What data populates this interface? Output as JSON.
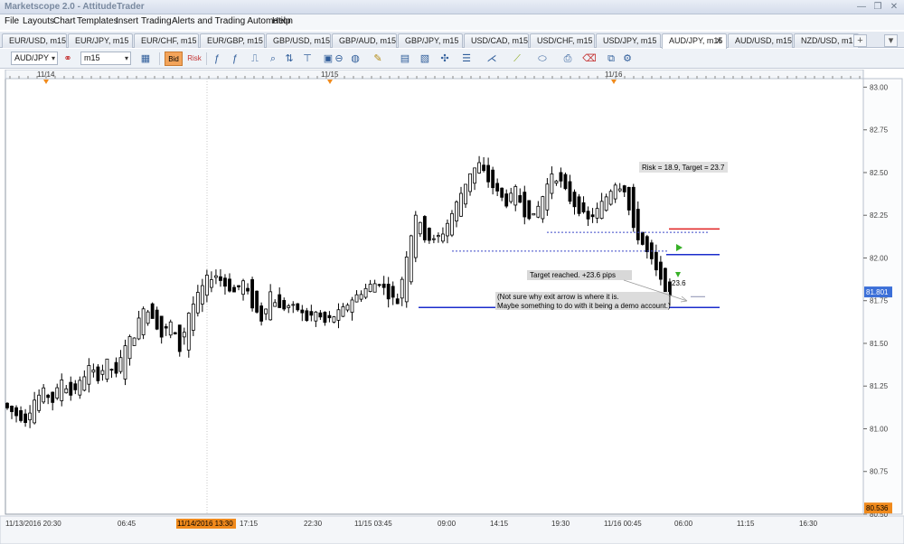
{
  "window": {
    "title": "Marketscope 2.0 - AttitudeTrader",
    "minimize_label": "—",
    "restore_label": "❐",
    "close_label": "✕"
  },
  "menu": [
    "File",
    "Layouts",
    "Chart",
    "Templates",
    "Insert",
    "Trading",
    "Alerts and Trading Automation",
    "Help"
  ],
  "tabs": [
    {
      "label": "EUR/USD, m15",
      "active": false
    },
    {
      "label": "EUR/JPY, m15",
      "active": false
    },
    {
      "label": "EUR/CHF, m15",
      "active": false
    },
    {
      "label": "EUR/GBP, m15",
      "active": false
    },
    {
      "label": "GBP/USD, m15",
      "active": false
    },
    {
      "label": "GBP/AUD, m15",
      "active": false
    },
    {
      "label": "GBP/JPY, m15",
      "active": false
    },
    {
      "label": "USD/CAD, m15",
      "active": false
    },
    {
      "label": "USD/CHF, m15",
      "active": false
    },
    {
      "label": "USD/JPY, m15",
      "active": false
    },
    {
      "label": "AUD/JPY, m15",
      "active": true
    },
    {
      "label": "AUD/USD, m15",
      "active": false
    },
    {
      "label": "NZD/USD, m15",
      "active": false
    }
  ],
  "tabs_extra": {
    "close_label": "✕",
    "add_label": "+",
    "more_label": "▾"
  },
  "toolbar": {
    "symbol": "AUD/JPY",
    "timeframe": "m15",
    "bid_label": "Bid",
    "risk_label": "Risk",
    "dropdown_arrow": "▾"
  },
  "chart_data": {
    "type": "candlestick",
    "symbol": "AUD/JPY",
    "timeframe": "m15",
    "ylim": [
      80.5,
      83.05
    ],
    "y_ticks": [
      "83.00",
      "82.75",
      "82.50",
      "82.25",
      "82.00",
      "81.75",
      "81.50",
      "81.25",
      "81.00",
      "80.75",
      "80.50"
    ],
    "x_labels": [
      "11/13/2016 20:30",
      "06:45",
      "11/14/2016 13:30",
      "17:15",
      "22:30",
      "11/15 03:45",
      "09:00",
      "14:15",
      "19:30",
      "11/16 00:45",
      "06:00",
      "11:15",
      "16:30"
    ],
    "highlighted_x_label": "11/14/2016 13:30",
    "date_markers": [
      "11/14",
      "11/15",
      "11/16"
    ],
    "current_price": "81.801",
    "bottom_price_marker": "80.536",
    "candles_sampled": [
      [
        81.15,
        81.22,
        81.07,
        81.12
      ],
      [
        81.12,
        81.18,
        81.03,
        81.08
      ],
      [
        81.08,
        81.14,
        80.98,
        81.05
      ],
      [
        81.05,
        81.2,
        81.01,
        81.17
      ],
      [
        81.17,
        81.27,
        81.12,
        81.22
      ],
      [
        81.22,
        81.26,
        81.13,
        81.16
      ],
      [
        81.16,
        81.32,
        81.12,
        81.29
      ],
      [
        81.29,
        81.36,
        81.16,
        81.2
      ],
      [
        81.2,
        81.3,
        81.16,
        81.27
      ],
      [
        81.27,
        81.4,
        81.22,
        81.36
      ],
      [
        81.36,
        81.41,
        81.25,
        81.3
      ],
      [
        81.3,
        81.42,
        81.26,
        81.39
      ],
      [
        81.39,
        81.44,
        81.28,
        81.31
      ],
      [
        81.31,
        81.52,
        81.29,
        81.5
      ],
      [
        81.5,
        81.6,
        81.45,
        81.55
      ],
      [
        81.55,
        81.75,
        81.52,
        81.72
      ],
      [
        81.72,
        81.84,
        81.62,
        81.66
      ],
      [
        81.66,
        81.72,
        81.5,
        81.54
      ],
      [
        81.54,
        81.65,
        81.48,
        81.62
      ],
      [
        81.62,
        81.66,
        81.4,
        81.46
      ],
      [
        81.46,
        81.7,
        81.44,
        81.68
      ],
      [
        81.68,
        81.82,
        81.64,
        81.78
      ],
      [
        81.78,
        81.92,
        81.74,
        81.88
      ],
      [
        81.88,
        81.96,
        81.82,
        81.9
      ],
      [
        81.9,
        81.94,
        81.8,
        81.84
      ],
      [
        81.84,
        81.9,
        81.76,
        81.8
      ],
      [
        81.8,
        81.99,
        81.78,
        81.86
      ],
      [
        81.86,
        81.91,
        81.7,
        81.72
      ],
      [
        81.72,
        81.8,
        81.58,
        81.64
      ],
      [
        81.64,
        81.84,
        81.6,
        81.8
      ],
      [
        81.8,
        81.86,
        81.68,
        81.7
      ],
      [
        81.7,
        81.76,
        81.62,
        81.72
      ],
      [
        81.72,
        81.8,
        81.66,
        81.7
      ],
      [
        81.7,
        81.75,
        81.6,
        81.64
      ],
      [
        81.64,
        81.72,
        81.57,
        81.68
      ],
      [
        81.68,
        81.74,
        81.6,
        81.62
      ],
      [
        81.62,
        81.7,
        81.56,
        81.66
      ],
      [
        81.66,
        81.74,
        81.62,
        81.7
      ],
      [
        81.7,
        81.8,
        81.66,
        81.76
      ],
      [
        81.76,
        81.84,
        81.72,
        81.8
      ],
      [
        81.8,
        81.87,
        81.74,
        81.84
      ],
      [
        81.84,
        81.92,
        81.78,
        81.86
      ],
      [
        81.86,
        81.9,
        81.72,
        81.78
      ],
      [
        81.78,
        81.82,
        81.71,
        81.74
      ],
      [
        81.74,
        82.06,
        81.72,
        82.02
      ],
      [
        82.02,
        82.3,
        81.98,
        82.26
      ],
      [
        82.26,
        82.3,
        82.08,
        82.12
      ],
      [
        82.12,
        82.2,
        82.04,
        82.1
      ],
      [
        82.1,
        82.18,
        82.06,
        82.15
      ],
      [
        82.15,
        82.3,
        82.1,
        82.26
      ],
      [
        82.26,
        82.42,
        82.22,
        82.38
      ],
      [
        82.38,
        82.52,
        82.34,
        82.5
      ],
      [
        82.5,
        82.58,
        82.44,
        82.55
      ],
      [
        82.55,
        82.57,
        82.42,
        82.45
      ],
      [
        82.45,
        82.5,
        82.34,
        82.38
      ],
      [
        82.38,
        82.42,
        82.26,
        82.32
      ],
      [
        82.32,
        82.46,
        82.28,
        82.4
      ],
      [
        82.4,
        82.44,
        82.22,
        82.26
      ],
      [
        82.26,
        82.3,
        82.15,
        82.24
      ],
      [
        82.24,
        82.38,
        82.2,
        82.36
      ],
      [
        82.36,
        82.52,
        82.32,
        82.5
      ],
      [
        82.5,
        82.6,
        82.4,
        82.44
      ],
      [
        82.44,
        82.48,
        82.3,
        82.34
      ],
      [
        82.34,
        82.4,
        82.24,
        82.28
      ],
      [
        82.28,
        82.34,
        82.16,
        82.22
      ],
      [
        82.22,
        82.32,
        82.18,
        82.28
      ],
      [
        82.28,
        82.4,
        82.24,
        82.36
      ],
      [
        82.36,
        82.48,
        82.3,
        82.44
      ],
      [
        82.44,
        82.5,
        82.36,
        82.4
      ],
      [
        82.4,
        82.44,
        82.12,
        82.16
      ],
      [
        82.16,
        82.2,
        82.04,
        82.08
      ],
      [
        82.08,
        82.1,
        81.96,
        81.98
      ],
      [
        81.98,
        82.0,
        81.82,
        81.86
      ],
      [
        81.86,
        81.88,
        81.72,
        81.78
      ]
    ],
    "annotations": {
      "risk_target": "Risk = 18.9, Target = 23.7",
      "target_reached": "Target reached. +23.6 pips",
      "pips_label": "23.6",
      "note_line1": "(Not sure why exit arrow is where it is.",
      "note_line2": "Maybe something to do with it being a demo account.)"
    },
    "levels": {
      "stop": 82.17,
      "entry": 82.02,
      "target": 81.71,
      "dotted_high": 82.15,
      "dotted_low": 82.04
    },
    "colors": {
      "bull": "#ffffff",
      "bear": "#000000",
      "stop": "#e02020",
      "entry": "#1b2ccc",
      "target": "#1b2ccc",
      "price_tag": "#3b6fd8",
      "marker_tag": "#f08a1c",
      "arrow": "#37b027"
    }
  }
}
